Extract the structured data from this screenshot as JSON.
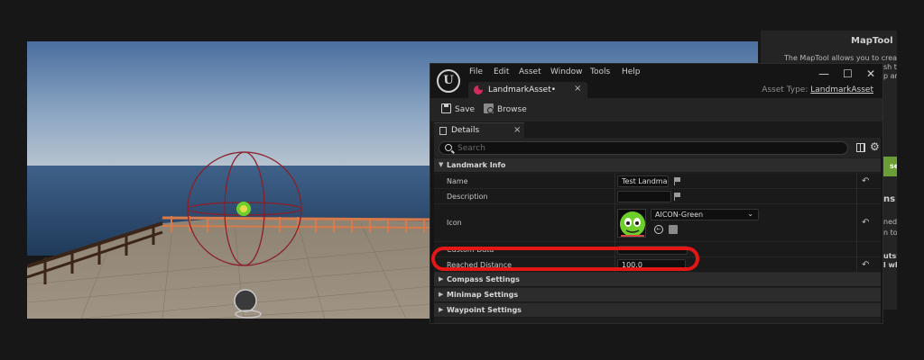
{
  "background_panel": {
    "title": "MapTool",
    "lines": [
      "The MapTool allows you to create c",
      "sh t",
      "p ar",
      "ns",
      "ned",
      "n to se",
      "utsi",
      "l wh"
    ],
    "button_label": "set"
  },
  "editor": {
    "menu": [
      "File",
      "Edit",
      "Asset",
      "Window",
      "Tools",
      "Help"
    ],
    "window_controls": {
      "minimize": "—",
      "maximize": "☐",
      "close": "✕"
    },
    "asset_tab": {
      "label": "LandmarkAsset•",
      "close": "×"
    },
    "asset_type": {
      "label": "Asset Type:",
      "value": "LandmarkAsset"
    },
    "toolbar": {
      "save_label": "Save",
      "browse_label": "Browse"
    },
    "details_tab": {
      "label": "Details",
      "close": "×"
    },
    "search": {
      "placeholder": "Search"
    },
    "categories": {
      "landmark_info": "Landmark Info",
      "compass": "Compass Settings",
      "minimap": "Minimap Settings",
      "waypoint": "Waypoint Settings"
    },
    "properties": {
      "name": {
        "label": "Name",
        "value": "Test Landmark"
      },
      "description": {
        "label": "Description",
        "value": ""
      },
      "icon": {
        "label": "Icon",
        "value": "AICON-Green"
      },
      "custom_data": {
        "label": "Custom Data",
        "value": ""
      },
      "reached_distance": {
        "label": "Reached Distance",
        "value": "100.0"
      }
    },
    "glyphs": {
      "expanded": "▼",
      "collapsed": "▶",
      "reset": "↶",
      "chevron": "⌄",
      "gear": "⚙"
    }
  },
  "colors": {
    "highlight": "#e51616",
    "sky_top": "#4a6fa0",
    "sea": "#2c4c73",
    "fence": "#d87a4a",
    "sphere": "#8a1f2a",
    "icon_green": "#6fcf2a"
  }
}
